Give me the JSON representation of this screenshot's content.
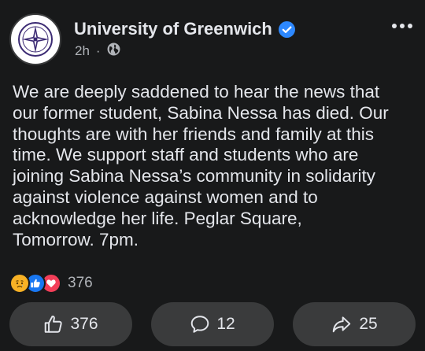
{
  "post": {
    "author": "University of Greenwich",
    "time": "2h",
    "separator": "·",
    "lines": [
      "We are deeply saddened to hear the news that",
      "our former student, Sabina Nessa has died. Our",
      "thoughts are with her friends and family at this",
      "time. We support staff and students who are",
      "joining Sabina Nessa’s community in solidarity",
      "against violence against women and to",
      "acknowledge her life. Peglar Square,",
      "Tomorrow. 7pm."
    ]
  },
  "reactions": {
    "icons": [
      "sad-icon",
      "like-icon",
      "love-icon"
    ],
    "count": "376"
  },
  "actions": {
    "like_count": "376",
    "comment_count": "12",
    "share_count": "25"
  },
  "colors": {
    "background": "#18191a",
    "text": "#e4e6eb",
    "secondary": "#b0b3b8",
    "button": "#3a3b3c",
    "verified": "#2d88ff"
  }
}
